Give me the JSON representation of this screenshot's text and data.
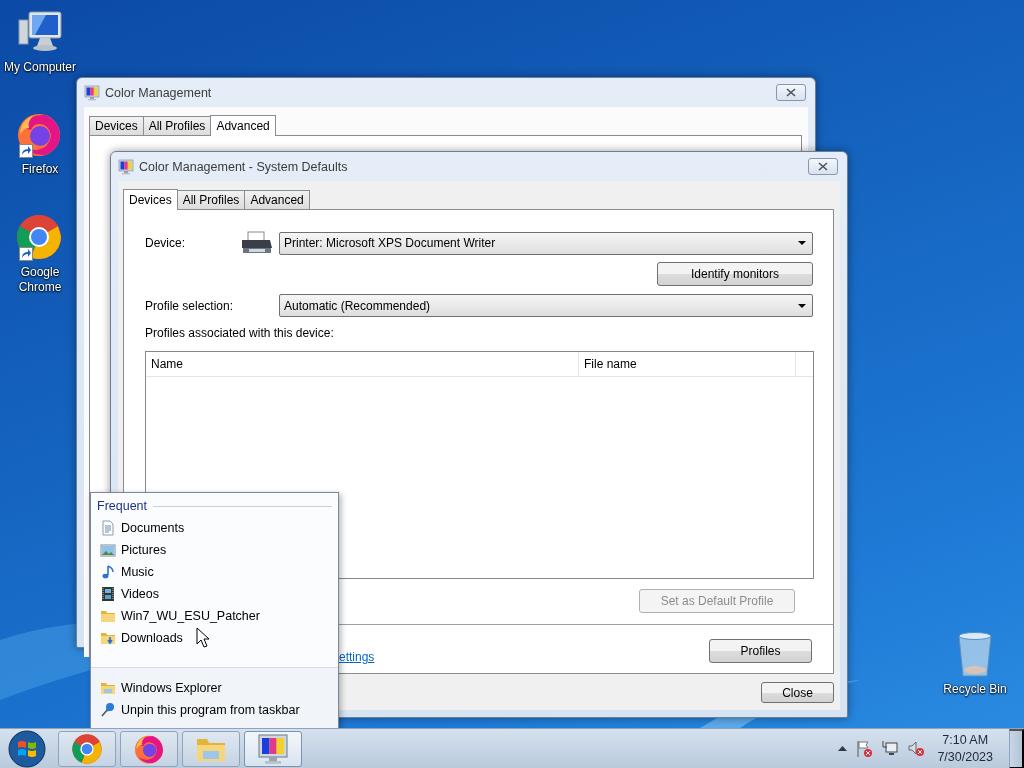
{
  "desktop_icons": [
    {
      "label": "My Computer",
      "kind": "computer",
      "shortcut": false
    },
    {
      "label": "Firefox",
      "kind": "firefox",
      "shortcut": true
    },
    {
      "label": "Google Chrome",
      "kind": "chrome",
      "shortcut": true
    },
    {
      "label": "Recycle Bin",
      "kind": "recycle",
      "shortcut": false
    }
  ],
  "back_window": {
    "title": "Color Management",
    "tabs": [
      {
        "label": "Devices",
        "selected": false
      },
      {
        "label": "All Profiles",
        "selected": false
      },
      {
        "label": "Advanced",
        "selected": true
      }
    ]
  },
  "dialog": {
    "title": "Color Management - System Defaults",
    "tabs": [
      {
        "label": "Devices",
        "selected": true
      },
      {
        "label": "All Profiles",
        "selected": false
      },
      {
        "label": "Advanced",
        "selected": false
      }
    ],
    "device_label": "Device:",
    "device_value": "Printer: Microsoft XPS Document Writer",
    "identify_button": "Identify monitors",
    "profile_selection_label": "Profile selection:",
    "profile_selection_value": "Automatic (Recommended)",
    "profiles_label": "Profiles associated with this device:",
    "profiles_table": {
      "columns": [
        "Name",
        "File name"
      ]
    },
    "set_default_button": {
      "label": "Set as Default Profile",
      "disabled": true
    },
    "settings_link": "ettings",
    "profiles_button": "Profiles",
    "close_button": "Close"
  },
  "jump_list": {
    "header": "Frequent",
    "items": [
      {
        "label": "Documents",
        "kind": "document"
      },
      {
        "label": "Pictures",
        "kind": "pictures"
      },
      {
        "label": "Music",
        "kind": "music"
      },
      {
        "label": "Videos",
        "kind": "videos"
      },
      {
        "label": "Win7_WU_ESU_Patcher",
        "kind": "folder"
      },
      {
        "label": "Downloads",
        "kind": "downloads"
      }
    ],
    "tasks": [
      {
        "label": "Windows Explorer",
        "kind": "explorer"
      },
      {
        "label": "Unpin this program from taskbar",
        "kind": "unpin"
      }
    ]
  },
  "taskbar": {
    "buttons": [
      {
        "kind": "chrome",
        "active": false
      },
      {
        "kind": "firefox",
        "active": false
      },
      {
        "kind": "explorer",
        "active": false
      },
      {
        "kind": "color",
        "active": true
      }
    ],
    "clock": {
      "time": "7:10 AM",
      "date": "7/30/2023"
    }
  }
}
